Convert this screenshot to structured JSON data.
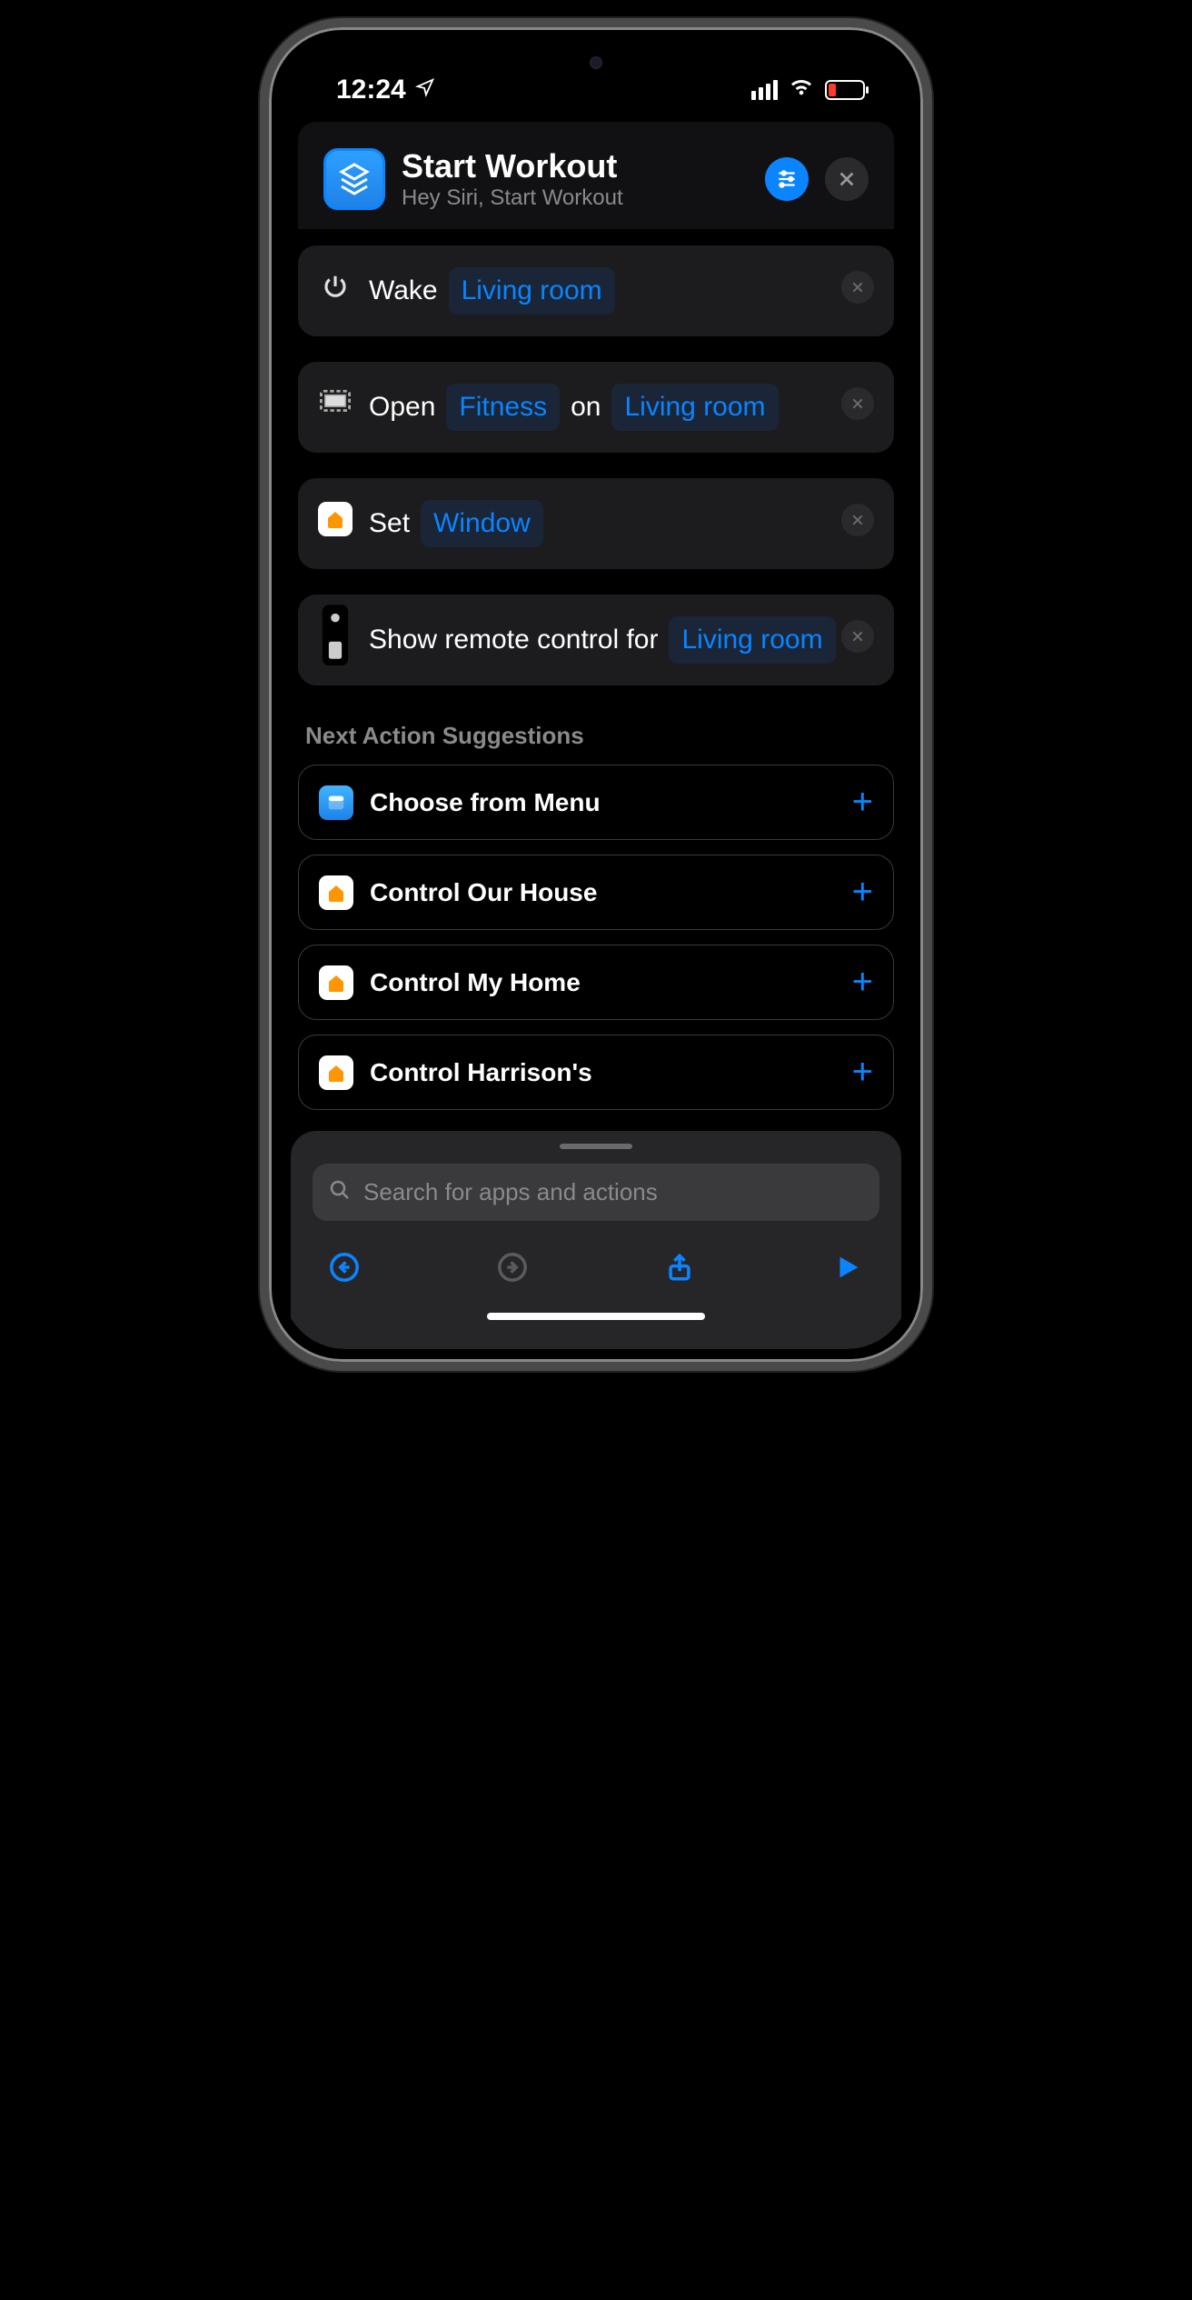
{
  "status": {
    "time": "12:24"
  },
  "header": {
    "title": "Start Workout",
    "subtitle": "Hey Siri, Start Workout"
  },
  "actions": [
    {
      "icon": "power",
      "parts": [
        {
          "t": "plain",
          "v": "Wake"
        },
        {
          "t": "token",
          "v": "Living room"
        }
      ]
    },
    {
      "icon": "tv",
      "parts": [
        {
          "t": "plain",
          "v": "Open"
        },
        {
          "t": "token",
          "v": "Fitness"
        },
        {
          "t": "plain",
          "v": "on"
        },
        {
          "t": "token",
          "v": "Living room"
        }
      ]
    },
    {
      "icon": "home",
      "parts": [
        {
          "t": "plain",
          "v": "Set"
        },
        {
          "t": "token",
          "v": "Window"
        }
      ]
    },
    {
      "icon": "remote",
      "parts": [
        {
          "t": "plain",
          "v": "Show remote control for"
        },
        {
          "t": "token",
          "v": "Living room"
        }
      ]
    }
  ],
  "suggestions_title": "Next Action Suggestions",
  "suggestions": [
    {
      "icon": "menu",
      "label": "Choose from Menu"
    },
    {
      "icon": "home",
      "label": "Control Our House"
    },
    {
      "icon": "home",
      "label": "Control My Home"
    },
    {
      "icon": "home",
      "label": "Control Harrison's"
    }
  ],
  "search": {
    "placeholder": "Search for apps and actions"
  }
}
